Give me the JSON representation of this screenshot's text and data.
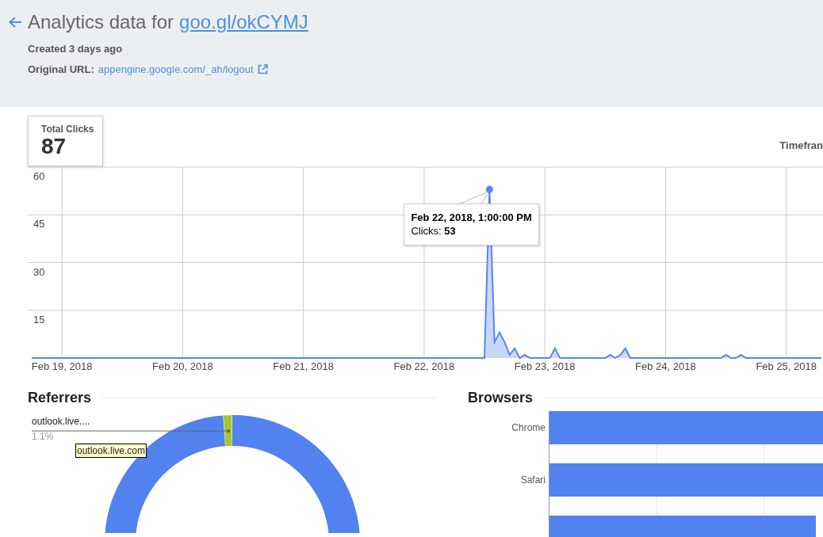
{
  "header": {
    "title": "Analytics data for",
    "short_link": "goo.gl/okCYMJ",
    "created": "Created 3 days ago",
    "original_url_label": "Original URL:",
    "original_url": "appengine.google.com/_ah/logout"
  },
  "total_clicks": {
    "label": "Total Clicks",
    "value": "87"
  },
  "timeframe_label": "Timefran",
  "clicks_chart": {
    "chart_data": {
      "type": "area",
      "grid": true,
      "x": [
        "2018-02-18T18:00",
        "2018-02-22T12:00",
        "2018-02-22T13:00",
        "2018-02-22T14:00",
        "2018-02-22T15:00",
        "2018-02-22T16:00",
        "2018-02-22T17:00",
        "2018-02-22T18:00",
        "2018-02-22T19:00",
        "2018-02-22T20:00",
        "2018-02-22T21:00",
        "2018-02-23T01:00",
        "2018-02-23T02:00",
        "2018-02-23T03:00",
        "2018-02-23T12:00",
        "2018-02-23T13:00",
        "2018-02-23T14:00",
        "2018-02-23T15:00",
        "2018-02-23T16:00",
        "2018-02-23T17:00",
        "2018-02-24T11:00",
        "2018-02-24T12:00",
        "2018-02-24T13:00",
        "2018-02-24T14:00",
        "2018-02-24T15:00",
        "2018-02-24T16:00",
        "2018-02-25T07:00"
      ],
      "values": [
        0,
        0,
        53,
        5,
        8,
        5,
        1,
        3,
        0,
        1,
        0,
        0,
        3,
        0,
        0,
        1,
        0,
        1,
        3,
        0,
        0,
        1,
        0,
        0,
        1,
        0,
        0
      ],
      "xlim": [
        "2018-02-18T17:12",
        "2018-02-25T07:18"
      ],
      "ylim": [
        0,
        60
      ],
      "xticks": [
        {
          "value": "2018-02-19T00:00",
          "label": "Feb 19, 2018"
        },
        {
          "value": "2018-02-20T00:00",
          "label": "Feb 20, 2018"
        },
        {
          "value": "2018-02-21T00:00",
          "label": "Feb 21, 2018"
        },
        {
          "value": "2018-02-22T00:00",
          "label": "Feb 22, 2018"
        },
        {
          "value": "2018-02-23T00:00",
          "label": "Feb 23, 2018"
        },
        {
          "value": "2018-02-24T00:00",
          "label": "Feb 24, 2018"
        },
        {
          "value": "2018-02-25T00:00",
          "label": "Feb 25, 2018"
        }
      ],
      "yticks": [
        15,
        30,
        45,
        60
      ]
    },
    "tooltip": {
      "title": "Feb 22, 2018, 1:00:00 PM",
      "body": "Clicks: **53**"
    }
  },
  "referrers": {
    "title": "Referrers",
    "chart_data": {
      "type": "donut",
      "categories": [
        "outlook.live....",
        null
      ],
      "values": [
        1.1,
        98.9
      ],
      "value_labels": [
        "1.1%",
        null
      ]
    },
    "tooltip": "outlook.live.com"
  },
  "browsers": {
    "title": "Browsers",
    "categories": [
      "Chrome",
      "Safari"
    ]
  }
}
